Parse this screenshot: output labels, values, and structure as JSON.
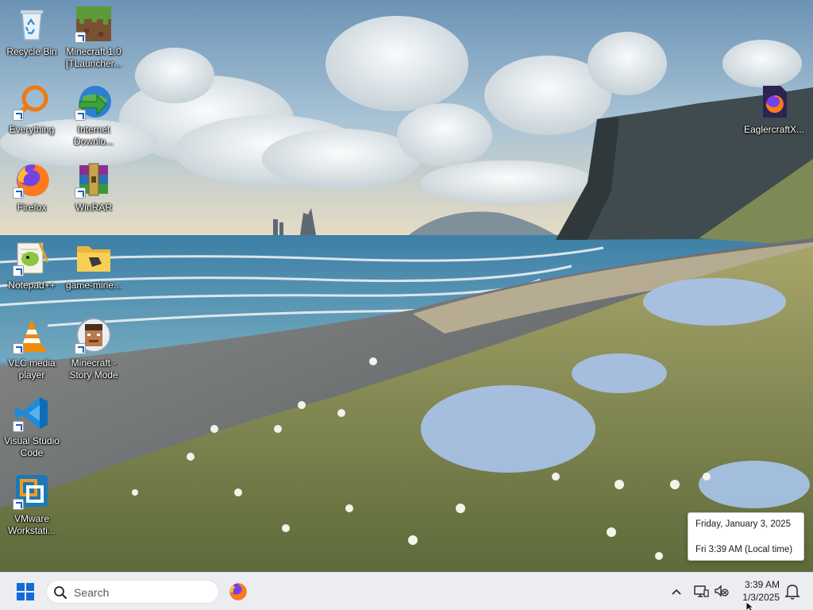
{
  "desktop": {
    "icons": [
      {
        "id": "recycle-bin",
        "label": "Recycle Bin"
      },
      {
        "id": "minecraft-launcher",
        "label": "Minecraft 1.0 [TLauncher..."
      },
      {
        "id": "everything",
        "label": "Everything"
      },
      {
        "id": "internet-download",
        "label": "Internet Downlo..."
      },
      {
        "id": "firefox",
        "label": "Firefox"
      },
      {
        "id": "winrar",
        "label": "WinRAR"
      },
      {
        "id": "notepadpp",
        "label": "Notepad++"
      },
      {
        "id": "game-folder",
        "label": "game-mine..."
      },
      {
        "id": "vlc",
        "label": "VLC media player"
      },
      {
        "id": "minecraft-story",
        "label": "Minecraft - Story Mode"
      },
      {
        "id": "vscode",
        "label": "Visual Studio Code"
      },
      {
        "id": "vmware",
        "label": "VMware Workstati..."
      },
      {
        "id": "eaglercraft",
        "label": "EaglercraftX..."
      }
    ]
  },
  "tooltip": {
    "date_long": "Friday, January 3, 2025",
    "time_long": "Fri 3:39 AM (Local time)"
  },
  "taskbar": {
    "search_placeholder": "Search",
    "clock_time": "3:39 AM",
    "clock_date": "1/3/2025"
  },
  "colors": {
    "taskbar_bg": "#ecedf1",
    "start_blue": "#0f6cd8",
    "firefox_orange": "#ff7a1a",
    "vscode_blue": "#1f8ad8"
  }
}
